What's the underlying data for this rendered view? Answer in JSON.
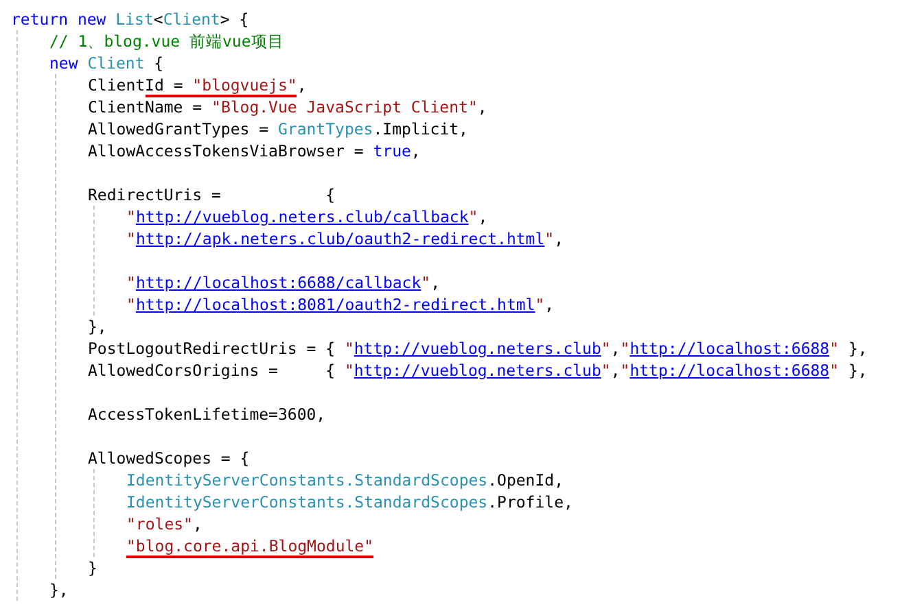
{
  "editor": {
    "lines": [
      {
        "kind": "code",
        "tokens": [
          {
            "kind": "keyword",
            "text": "return new"
          },
          {
            "kind": "type",
            "text": " List"
          },
          {
            "kind": "plain",
            "text": "<"
          },
          {
            "kind": "type",
            "text": "Client"
          },
          {
            "kind": "plain",
            "text": "> {"
          }
        ],
        "children": [
          {
            "kind": "code",
            "tokens": [
              {
                "kind": "comment",
                "text": "// 1、blog.vue 前端vue项目"
              }
            ]
          },
          {
            "kind": "code",
            "tokens": [
              {
                "kind": "keyword",
                "text": "new"
              },
              {
                "kind": "type",
                "text": " Client"
              },
              {
                "kind": "plain",
                "text": " {"
              }
            ],
            "children": [
              {
                "kind": "code",
                "tokens": [
                  {
                    "kind": "plain",
                    "text": "Client"
                  },
                  {
                    "kind": "plain",
                    "text": "Id = ",
                    "underlined": true
                  },
                  {
                    "kind": "string",
                    "text": "\"blogvuejs\"",
                    "underlined": true
                  },
                  {
                    "kind": "plain",
                    "text": ","
                  }
                ]
              },
              {
                "kind": "code",
                "tokens": [
                  {
                    "kind": "plain",
                    "text": "ClientName = "
                  },
                  {
                    "kind": "string",
                    "text": "\"Blog.Vue JavaScript Client\""
                  },
                  {
                    "kind": "plain",
                    "text": ","
                  }
                ]
              },
              {
                "kind": "code",
                "tokens": [
                  {
                    "kind": "plain",
                    "text": "AllowedGrantTypes = "
                  },
                  {
                    "kind": "type",
                    "text": "GrantTypes"
                  },
                  {
                    "kind": "plain",
                    "text": ".Implicit,"
                  }
                ]
              },
              {
                "kind": "code",
                "tokens": [
                  {
                    "kind": "plain",
                    "text": "AllowAccessTokensViaBrowser = "
                  },
                  {
                    "kind": "keyword",
                    "text": "true"
                  },
                  {
                    "kind": "plain",
                    "text": ","
                  }
                ]
              },
              {
                "kind": "blank"
              },
              {
                "kind": "code",
                "tokens": [
                  {
                    "kind": "plain",
                    "text": "RedirectUris =           {"
                  }
                ],
                "children": [
                  {
                    "kind": "code",
                    "tokens": [
                      {
                        "kind": "string",
                        "text": "\""
                      },
                      {
                        "kind": "link",
                        "text": "http://vueblog.neters.club/callback"
                      },
                      {
                        "kind": "string",
                        "text": "\""
                      },
                      {
                        "kind": "plain",
                        "text": ","
                      }
                    ]
                  },
                  {
                    "kind": "code",
                    "tokens": [
                      {
                        "kind": "string",
                        "text": "\""
                      },
                      {
                        "kind": "link",
                        "text": "http://apk.neters.club/oauth2-redirect.html"
                      },
                      {
                        "kind": "string",
                        "text": "\""
                      },
                      {
                        "kind": "plain",
                        "text": ","
                      }
                    ]
                  },
                  {
                    "kind": "blank"
                  },
                  {
                    "kind": "code",
                    "tokens": [
                      {
                        "kind": "string",
                        "text": "\""
                      },
                      {
                        "kind": "link",
                        "text": "http://localhost:6688/callback"
                      },
                      {
                        "kind": "string",
                        "text": "\""
                      },
                      {
                        "kind": "plain",
                        "text": ","
                      }
                    ]
                  },
                  {
                    "kind": "code",
                    "tokens": [
                      {
                        "kind": "string",
                        "text": "\""
                      },
                      {
                        "kind": "link",
                        "text": "http://localhost:8081/oauth2-redirect.html"
                      },
                      {
                        "kind": "string",
                        "text": "\""
                      },
                      {
                        "kind": "plain",
                        "text": ","
                      }
                    ]
                  }
                ]
              },
              {
                "kind": "code",
                "tokens": [
                  {
                    "kind": "plain",
                    "text": "},"
                  }
                ]
              },
              {
                "kind": "code",
                "tokens": [
                  {
                    "kind": "plain",
                    "text": "PostLogoutRedirectUris = { "
                  },
                  {
                    "kind": "string",
                    "text": "\""
                  },
                  {
                    "kind": "link",
                    "text": "http://vueblog.neters.club"
                  },
                  {
                    "kind": "string",
                    "text": "\""
                  },
                  {
                    "kind": "plain",
                    "text": ","
                  },
                  {
                    "kind": "string",
                    "text": "\""
                  },
                  {
                    "kind": "link",
                    "text": "http://localhost:6688"
                  },
                  {
                    "kind": "string",
                    "text": "\""
                  },
                  {
                    "kind": "plain",
                    "text": " },"
                  }
                ]
              },
              {
                "kind": "code",
                "tokens": [
                  {
                    "kind": "plain",
                    "text": "AllowedCorsOrigins =     { "
                  },
                  {
                    "kind": "string",
                    "text": "\""
                  },
                  {
                    "kind": "link",
                    "text": "http://vueblog.neters.club"
                  },
                  {
                    "kind": "string",
                    "text": "\""
                  },
                  {
                    "kind": "plain",
                    "text": ","
                  },
                  {
                    "kind": "string",
                    "text": "\""
                  },
                  {
                    "kind": "link",
                    "text": "http://localhost:6688"
                  },
                  {
                    "kind": "string",
                    "text": "\""
                  },
                  {
                    "kind": "plain",
                    "text": " },"
                  }
                ]
              },
              {
                "kind": "blank"
              },
              {
                "kind": "code",
                "tokens": [
                  {
                    "kind": "plain",
                    "text": "AccessTokenLifetime=3600,"
                  }
                ]
              },
              {
                "kind": "blank"
              },
              {
                "kind": "code",
                "tokens": [
                  {
                    "kind": "plain",
                    "text": "AllowedScopes = {"
                  }
                ],
                "children": [
                  {
                    "kind": "code",
                    "tokens": [
                      {
                        "kind": "type",
                        "text": "IdentityServerConstants.StandardScopes"
                      },
                      {
                        "kind": "plain",
                        "text": ".OpenId,"
                      }
                    ]
                  },
                  {
                    "kind": "code",
                    "tokens": [
                      {
                        "kind": "type",
                        "text": "IdentityServerConstants.StandardScopes"
                      },
                      {
                        "kind": "plain",
                        "text": ".Profile,"
                      }
                    ]
                  },
                  {
                    "kind": "code",
                    "tokens": [
                      {
                        "kind": "string",
                        "text": "\"roles\""
                      },
                      {
                        "kind": "plain",
                        "text": ","
                      }
                    ]
                  },
                  {
                    "kind": "code",
                    "tokens": [
                      {
                        "kind": "string",
                        "text": "\"blog.core.api.BlogModule\"",
                        "underlined": true
                      }
                    ]
                  }
                ]
              },
              {
                "kind": "code",
                "tokens": [
                  {
                    "kind": "plain",
                    "text": "}"
                  }
                ]
              }
            ]
          },
          {
            "kind": "code",
            "tokens": [
              {
                "kind": "plain",
                "text": "},"
              }
            ]
          }
        ]
      }
    ]
  }
}
